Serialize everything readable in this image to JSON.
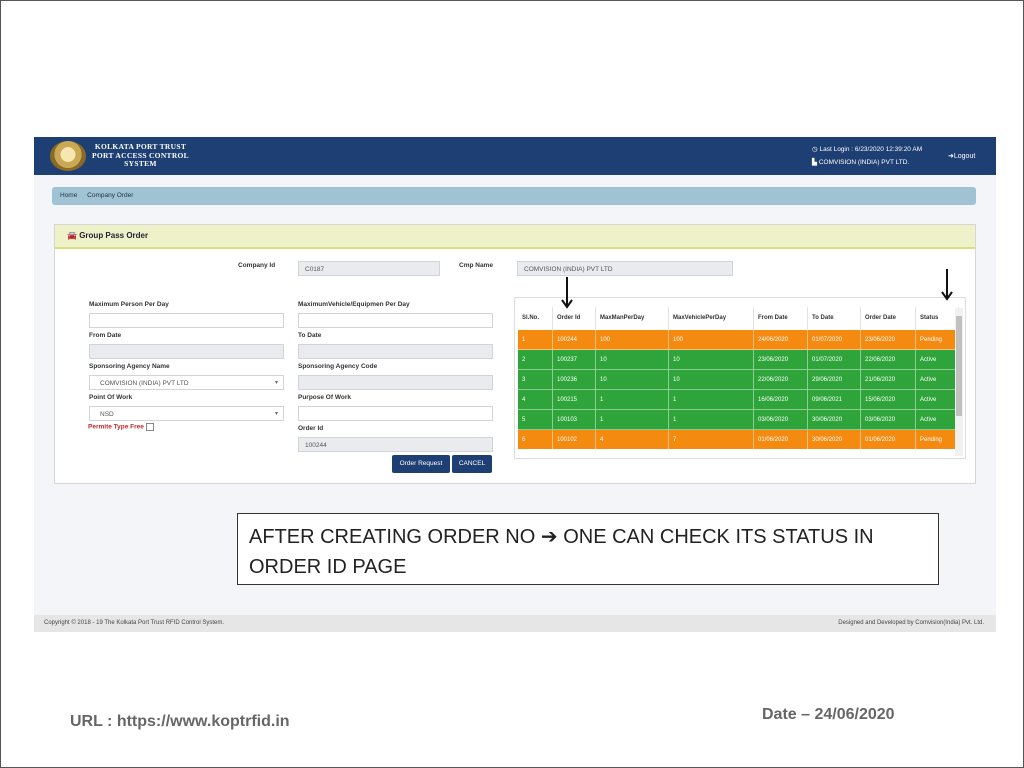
{
  "header": {
    "brand_line1": "KOLKATA PORT TRUST",
    "brand_line2": "PORT ACCESS CONTROL",
    "brand_line3": "SYSTEM",
    "last_login": "Last Login : 6/23/2020 12:39:20 AM",
    "company_user": "COMVISION (INDIA) PVT LTD.",
    "logout": "Logout"
  },
  "breadcrumb": {
    "home": "Home",
    "current": "Company Order"
  },
  "panel": {
    "title": "Group Pass Order"
  },
  "form": {
    "company_id_label": "Company Id",
    "company_id_value": "C0187",
    "cmp_name_label": "Cmp Name",
    "cmp_name_value": "COMVISION (INDIA) PVT LTD",
    "max_person_label": "Maximum Person Per Day",
    "max_person_value": "",
    "max_vehicle_label": "MaximumVehicle/Equipmen Per Day",
    "max_vehicle_value": "",
    "from_date_label": "From Date",
    "to_date_label": "To Date",
    "sponsoring_agency_name_label": "Sponsoring Agency Name",
    "sponsoring_agency_name_value": "COMVISION (INDIA) PVT LTD",
    "sponsoring_agency_code_label": "Sponsoring Agency Code",
    "point_of_work_label": "Point Of Work",
    "point_of_work_value": "NSD",
    "purpose_of_work_label": "Purpose Of Work",
    "permit_type_free_label": "Permite Type Free",
    "order_id_label": "Order Id",
    "order_id_value": "100244",
    "order_request_button": "Order Request",
    "cancel_button": "CANCEL"
  },
  "orders_table": {
    "columns": [
      "Sl.No.",
      "Order Id",
      "MaxManPerDay",
      "MaxVehiclePerDay",
      "From Date",
      "To Date",
      "Order Date",
      "Status"
    ],
    "rows": [
      {
        "sl": "1",
        "order_id": "100244",
        "max_man": "100",
        "max_vehicle": "100",
        "from_date": "24/06/2020",
        "to_date": "01/07/2020",
        "order_date": "23/06/2020",
        "status": "Pending"
      },
      {
        "sl": "2",
        "order_id": "100237",
        "max_man": "10",
        "max_vehicle": "10",
        "from_date": "23/06/2020",
        "to_date": "01/07/2020",
        "order_date": "22/06/2020",
        "status": "Active"
      },
      {
        "sl": "3",
        "order_id": "100236",
        "max_man": "10",
        "max_vehicle": "10",
        "from_date": "22/06/2020",
        "to_date": "29/06/2020",
        "order_date": "21/06/2020",
        "status": "Active"
      },
      {
        "sl": "4",
        "order_id": "100215",
        "max_man": "1",
        "max_vehicle": "1",
        "from_date": "16/06/2020",
        "to_date": "09/06/2021",
        "order_date": "15/06/2020",
        "status": "Active"
      },
      {
        "sl": "5",
        "order_id": "100103",
        "max_man": "1",
        "max_vehicle": "1",
        "from_date": "03/06/2020",
        "to_date": "30/06/2020",
        "order_date": "03/06/2020",
        "status": "Active"
      },
      {
        "sl": "6",
        "order_id": "100102",
        "max_man": "4",
        "max_vehicle": "7",
        "from_date": "01/06/2020",
        "to_date": "30/06/2020",
        "order_date": "01/06/2020",
        "status": "Pending"
      }
    ]
  },
  "footer": {
    "copyright": "Copyright © 2018 - 19 The Kolkata Port Trust RFID Control System.",
    "designed_by": "Designed and Developed by Comvision(India) Pvt. Ltd."
  },
  "slide": {
    "note_part1": "AFTER CREATING ORDER NO",
    "note_arrow": "➔",
    "note_part2": "ONE CAN CHECK ITS STATUS IN ORDER ID PAGE",
    "url": "URL : https://www.koptrfid.in",
    "date": "Date – 24/06/2020"
  },
  "colors": {
    "header": "#1d3f73",
    "pending": "#f58a10",
    "active": "#2ea43a",
    "breadcrumb": "#9fc3d3"
  },
  "icons": [
    "logo-emblem",
    "clock-icon",
    "building-icon",
    "logout-icon",
    "car-icon",
    "chevron-down-icon",
    "down-arrow-annotation"
  ]
}
